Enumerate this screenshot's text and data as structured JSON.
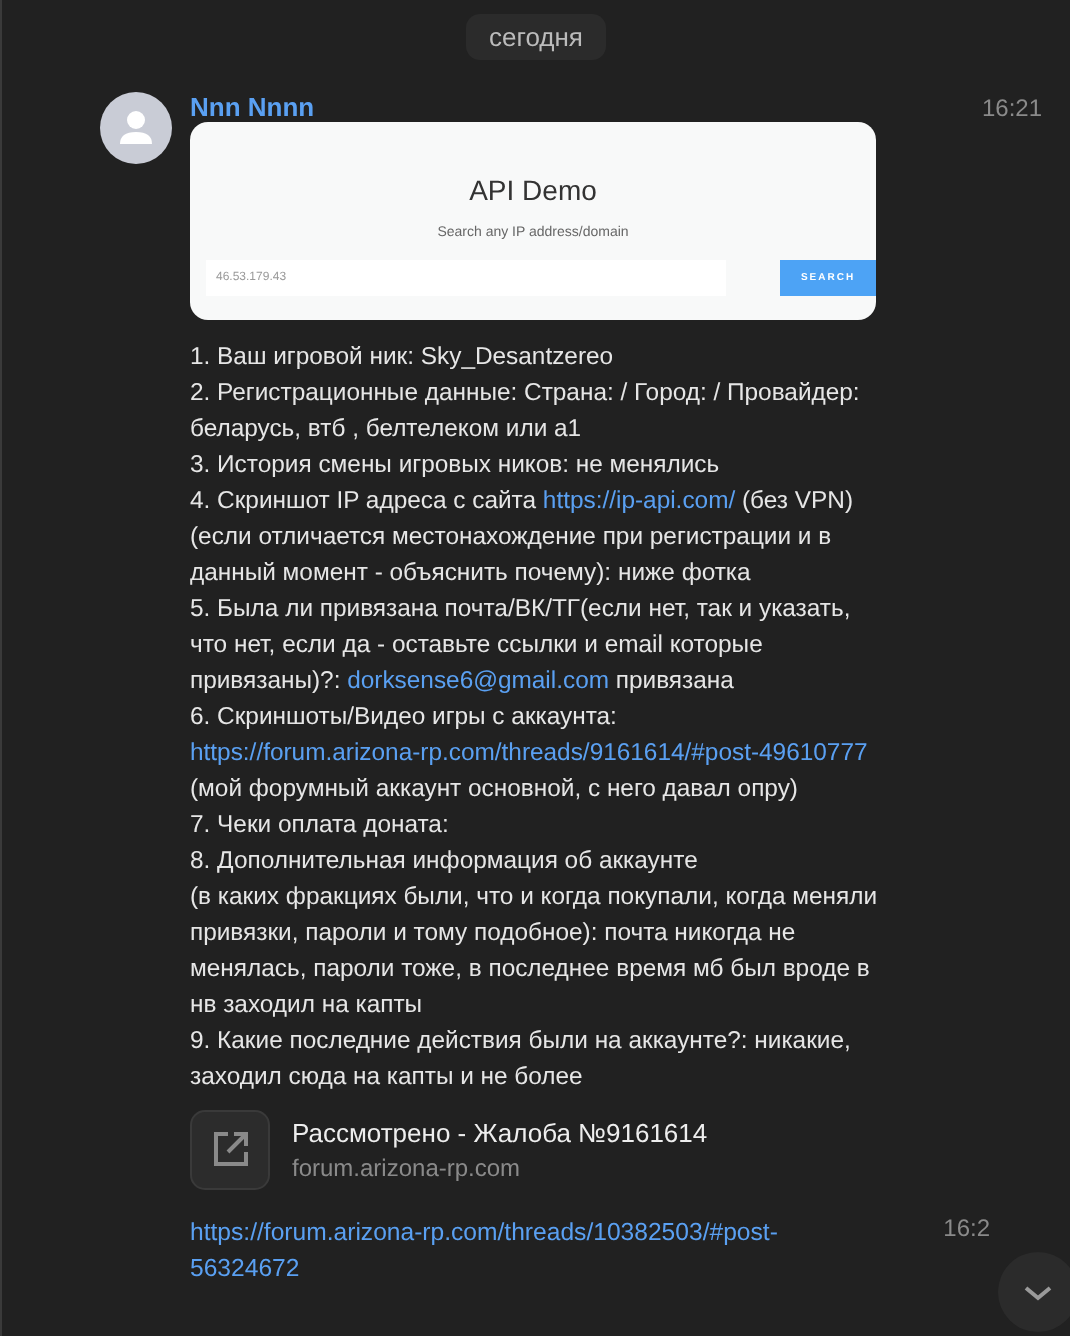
{
  "date_separator": "сегодня",
  "message": {
    "author": "Nnn Nnnn",
    "time": "16:21",
    "screenshot": {
      "title": "API Demo",
      "subtitle": "Search any IP address/domain",
      "input_value": "46.53.179.43",
      "button": "SEARCH"
    },
    "paragraphs": [
      [
        {
          "kind": "text",
          "text": "1. Ваш игровой ник: Sky_Desantzereo"
        }
      ],
      [
        {
          "kind": "text",
          "text": "2. Регистрационные данные: Страна: / Город: / Провайдер: беларусь, втб , белтелеком или а1"
        }
      ],
      [
        {
          "kind": "text",
          "text": "3. История смены игровых ников: не менялись"
        }
      ],
      [
        {
          "kind": "text",
          "text": "4. Скриншот IP адреса с сайта "
        },
        {
          "kind": "link",
          "text": "https://ip-api.com/"
        },
        {
          "kind": "text",
          "text": " (без VPN) (если отличается местонахождение при регистрации и в данный момент - объяснить почему): ниже фотка"
        }
      ],
      [
        {
          "kind": "text",
          "text": "5. Была ли привязана почта/ВК/ТГ(если нет, так и указать, что нет, если да - оставьте ссылки и email которые привязаны)?: "
        },
        {
          "kind": "link",
          "text": "dorksense6@gmail.com"
        },
        {
          "kind": "text",
          "text": " привязана"
        }
      ],
      [
        {
          "kind": "text",
          "text": "6. Скриншоты/Видео игры с аккаунта: "
        },
        {
          "kind": "link",
          "text": "https://forum.arizona-rp.com/threads/9161614/#post-49610777"
        },
        {
          "kind": "text",
          "text": " (мой форумный аккаунт основной, с него давал опру)"
        }
      ],
      [
        {
          "kind": "text",
          "text": "7. Чеки оплата доната:"
        }
      ],
      [
        {
          "kind": "text",
          "text": "8. Дополнительная информация об аккаунте"
        }
      ],
      [
        {
          "kind": "text",
          "text": "(в каких фракциях были, что и когда покупали, когда меняли привязки, пароли и тому подобное): почта никогда не менялась, пароли тоже, в последнее время мб был вроде в нв заходил на капты"
        }
      ],
      [
        {
          "kind": "text",
          "text": "9. Какие последние действия были на аккаунте?: никакие, заходил сюда на капты и не более"
        }
      ]
    ],
    "link_preview": {
      "title": "Рассмотрено - Жалоба №9161614",
      "domain": "forum.arizona-rp.com"
    }
  },
  "next_message": {
    "link": "https://forum.arizona-rp.com/threads/10382503/#post-56324672",
    "time": "16:2"
  }
}
